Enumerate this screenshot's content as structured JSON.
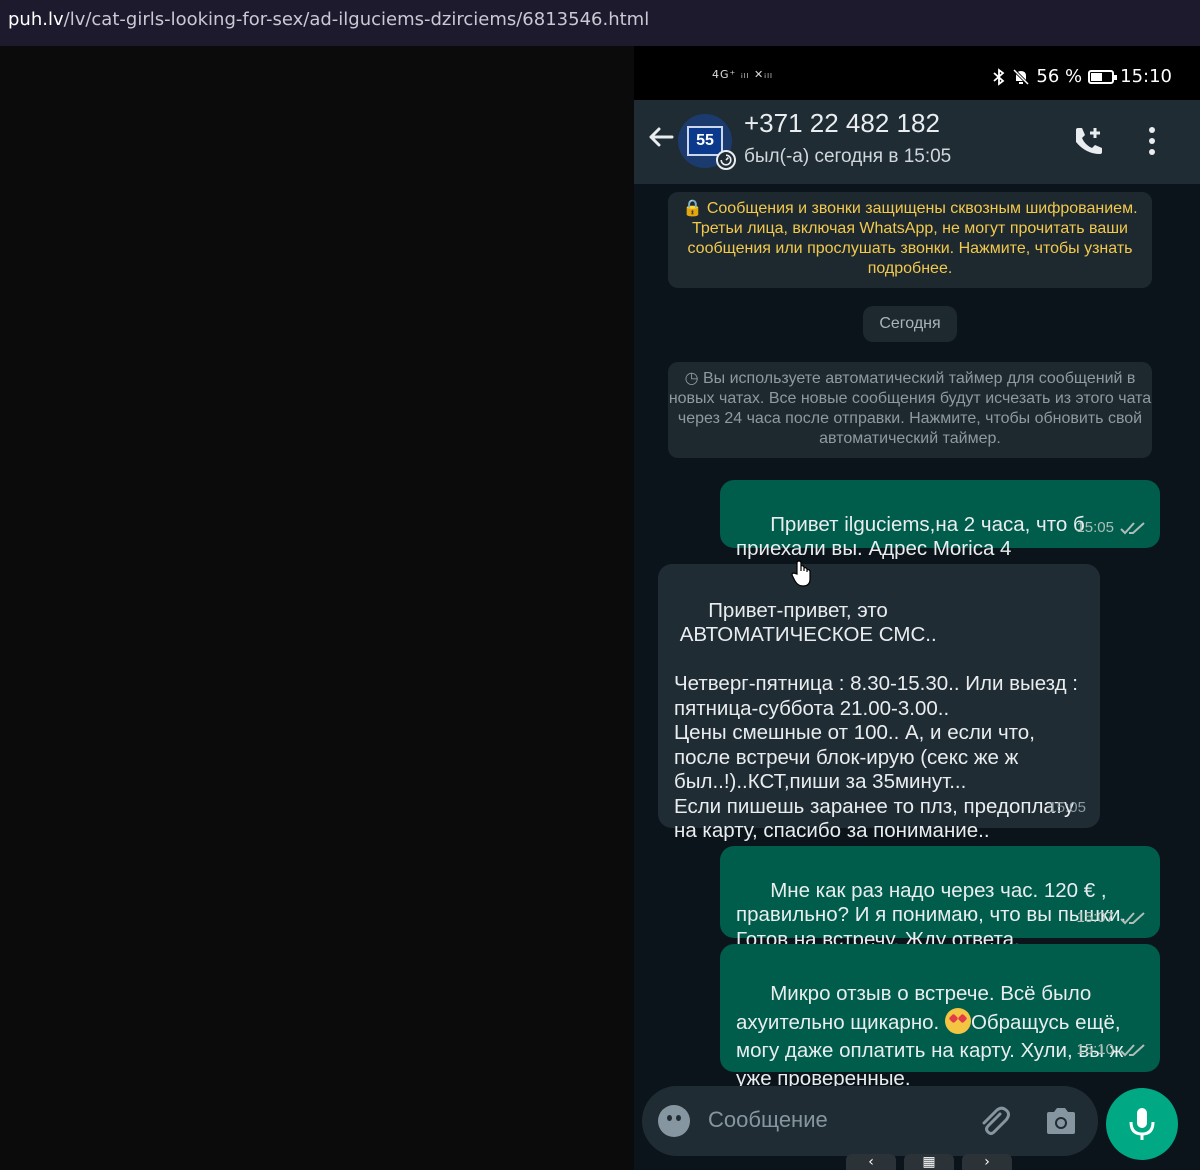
{
  "browser": {
    "url_host": "puh.lv",
    "url_path": "/lv/cat-girls-looking-for-sex/ad-ilguciems-dzirciems/6813546.html"
  },
  "status_bar": {
    "network": "4G⁺ ᵢₗₗ ✕ᵢₗₗ",
    "battery_text": "56 %",
    "battery_level": 0.56,
    "time": "15:10"
  },
  "chat_header": {
    "contact": "+371 22 482 182",
    "last_seen": "был(-а) сегодня в 15:05",
    "avatar_text": "55"
  },
  "encryption_notice": "🔒 Сообщения и звонки защищены сквозным шифрованием. Третьи лица, включая WhatsApp, не могут прочитать ваши сообщения или прослушать звонки. Нажмите, чтобы узнать подробнее.",
  "day_chip": "Сегодня",
  "timer_notice": "Вы используете автоматический таймер для сообщений в новых чатах. Все новые сообщения будут исчезать из этого чата через 24 часа после отправки. Нажмите, чтобы обновить свой автоматический таймер.",
  "messages": [
    {
      "direction": "out",
      "text": "Привет ilguciems,на 2 часа, что б приехали вы. Адрес Morica 4",
      "time": "15:05",
      "read": true
    },
    {
      "direction": "in",
      "text": "Привет-привет, это\n АВТОМАТИЧЕСКОЕ СМС..\n\nЧетверг-пятница : 8.30-15.30.. Или выезд : пятница-суббота 21.00-3.00..\nЦены смешные от 100.. А, и если что, после встречи блок-ирую (секс же ж был..!)..КСТ,пиши за 35минут...\nЕсли пишешь заранее то плз, предоплату на карту, спасибо за понимание..",
      "time": "15:05"
    },
    {
      "direction": "out",
      "text": "Мне как раз надо через час. 120 € , правильно? И я понимаю, что вы пышки. Готов на встречу. Жду ответа.",
      "time": "15:07",
      "read": true
    },
    {
      "direction": "out",
      "text_before_emoji": "Микро отзыв о встрече. Всё было ахуительно щикарно. ",
      "emoji": "heart-eyes-emoji",
      "text_after_emoji": "Обращусь ещё, могу даже оплатить на карту. Хули, вы ж уже проверенные.",
      "time": "15:10",
      "read": true
    }
  ],
  "composer": {
    "placeholder": "Сообщение"
  },
  "icons": [
    "back-arrow-icon",
    "add-call-icon",
    "more-vert-icon",
    "lock-icon",
    "timer-icon",
    "double-check-icon",
    "emoji-icon",
    "attach-icon",
    "camera-icon",
    "mic-icon",
    "hand-cursor-icon"
  ],
  "colors": {
    "header_bg": "#1f2c34",
    "chat_bg": "#0b141a",
    "outgoing_bubble": "#005c4b",
    "incoming_bubble": "#202c33",
    "accent": "#00a884",
    "notice_text": "#f2c94c"
  }
}
